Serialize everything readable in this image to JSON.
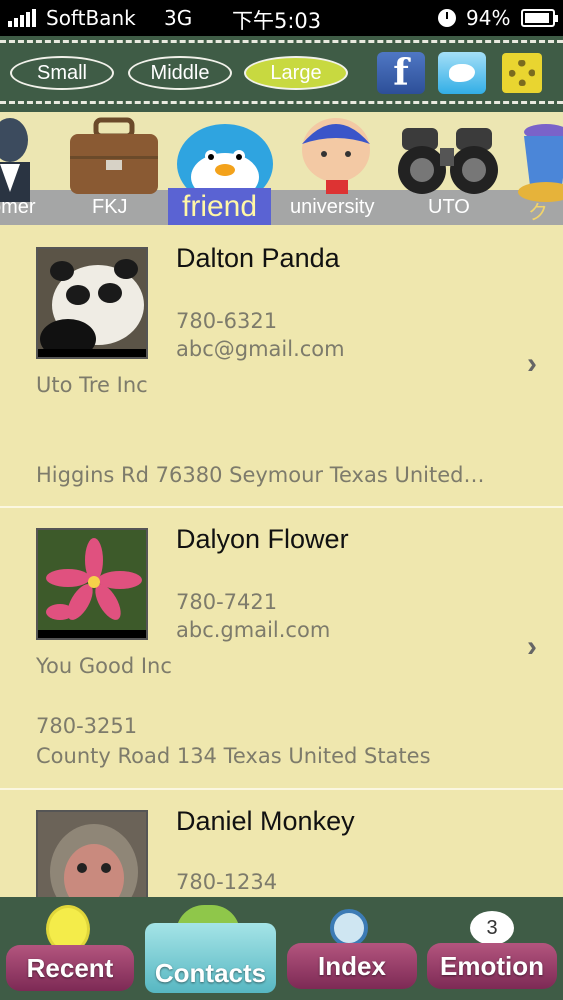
{
  "status_bar": {
    "carrier": "SoftBank",
    "network": "3G",
    "time": "下午5:03",
    "battery": "94%",
    "battery_level": 0.94
  },
  "size_options": [
    {
      "label": "Small",
      "selected": false
    },
    {
      "label": "Middle",
      "selected": false
    },
    {
      "label": "Large",
      "selected": true
    }
  ],
  "social": {
    "facebook": "facebook-icon",
    "twitter": "twitter-icon",
    "settings": "gear-icon"
  },
  "categories": [
    {
      "label": "omer",
      "icon": "businessman-icon"
    },
    {
      "label": "FKJ",
      "icon": "briefcase-icon"
    },
    {
      "label": "friend",
      "icon": "penguin-icon",
      "active": true
    },
    {
      "label": "university",
      "icon": "student-icon"
    },
    {
      "label": "UTO",
      "icon": "binoculars-icon"
    },
    {
      "label": "ク",
      "icon": "bucket-icon"
    }
  ],
  "contacts": [
    {
      "name": "Dalton Panda",
      "phone": "780-6321",
      "email": "abc@gmail.com",
      "company": "Uto Tre Inc",
      "phone2": "",
      "address": "Higgins Rd 76380 Seymour Texas United…",
      "photo": "panda-photo"
    },
    {
      "name": "Dalyon Flower",
      "phone": "780-7421",
      "email": "abc.gmail.com",
      "company": "You Good Inc",
      "phone2": "780-3251",
      "address": "County Road 134 Texas United States",
      "photo": "flower-photo"
    },
    {
      "name": "Daniel Monkey",
      "phone": "780-1234",
      "photo": "monkey-photo"
    }
  ],
  "tabs": {
    "recent": "Recent",
    "contacts": "Contacts",
    "index": "Index",
    "emotion": "Emotion"
  },
  "colors": {
    "chalkboard": "#3f5c46",
    "list_bg": "#efe7ae",
    "active_category": "#5a63d3",
    "tab_pink": "#9a3d67",
    "tab_teal": "#7fcfd6"
  }
}
